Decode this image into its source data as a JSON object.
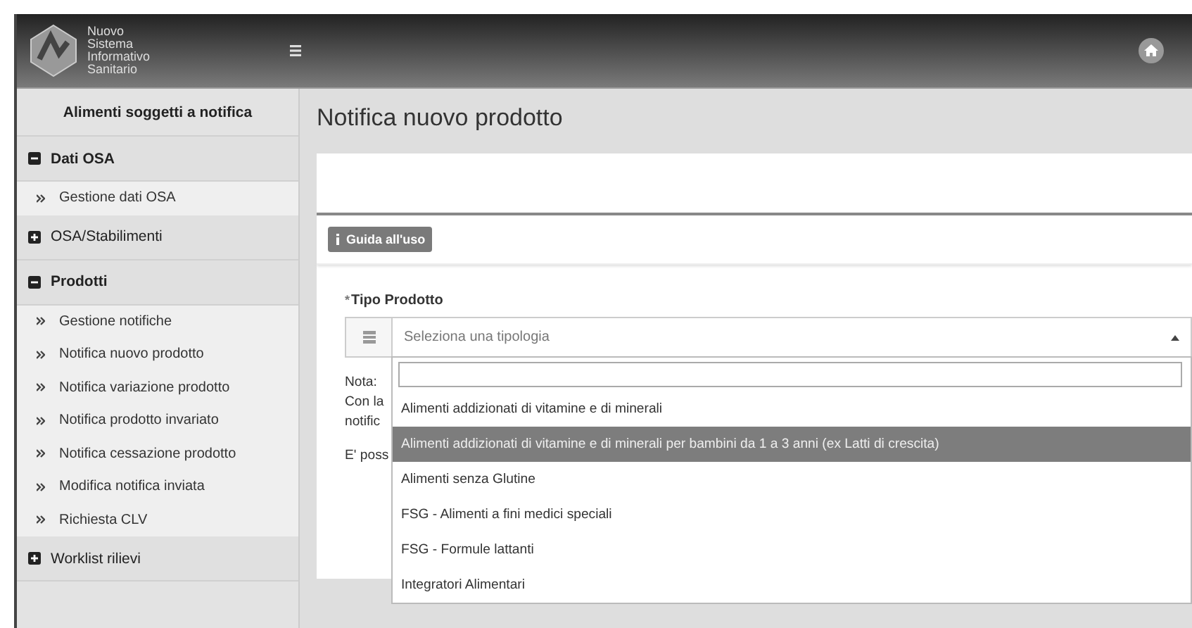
{
  "header": {
    "logo_lines": [
      "Nuovo",
      "Sistema",
      "Informativo",
      "Sanitario"
    ]
  },
  "sidebar": {
    "title": "Alimenti soggetti a notifica",
    "sections": [
      {
        "label": "Dati OSA",
        "expanded": true,
        "children": [
          "Gestione dati OSA"
        ]
      },
      {
        "label": "OSA/Stabilimenti",
        "expanded": false
      },
      {
        "label": "Prodotti",
        "expanded": true,
        "children": [
          "Gestione notifiche",
          "Notifica nuovo prodotto",
          "Notifica variazione prodotto",
          "Notifica prodotto invariato",
          "Notifica cessazione prodotto",
          "Modifica notifica inviata",
          "Richiesta CLV"
        ]
      },
      {
        "label": "Worklist rilievi",
        "expanded": false
      }
    ]
  },
  "page": {
    "title": "Notifica nuovo prodotto",
    "guide_button": "Guida all'uso",
    "field": {
      "required_mark": "*",
      "label": "Tipo Prodotto",
      "placeholder": "Seleziona una tipologia",
      "open": true
    },
    "note_lines": [
      "Nota:",
      "Con la",
      "notific",
      "E' poss"
    ],
    "options": [
      {
        "label": "Alimenti addizionati di vitamine e di minerali",
        "selected": false
      },
      {
        "label": "Alimenti addizionati di vitamine e di minerali per bambini da 1 a 3 anni (ex Latti di crescita)",
        "selected": true
      },
      {
        "label": "Alimenti senza Glutine",
        "selected": false
      },
      {
        "label": "FSG - Alimenti a fini medici speciali",
        "selected": false
      },
      {
        "label": "FSG - Formule lattanti",
        "selected": false
      },
      {
        "label": "Integratori Alimentari",
        "selected": false
      }
    ]
  }
}
